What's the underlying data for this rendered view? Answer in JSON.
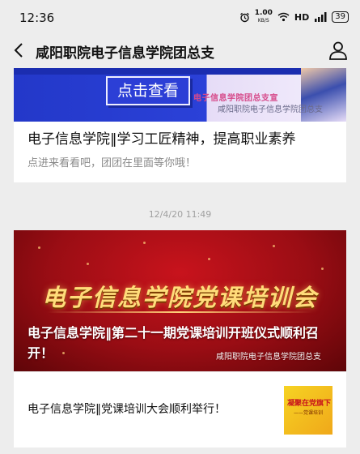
{
  "status_bar": {
    "time": "12:36",
    "net_speed_value": "1.00",
    "net_speed_unit": "KB/S",
    "network": "HD",
    "battery": "39"
  },
  "nav": {
    "title": "咸阳职院电子信息学院团总支",
    "icons": [
      "chevron-left-icon",
      "person-icon"
    ]
  },
  "article1": {
    "banner_button": "点击查看",
    "banner_brand": "电子信息学院团总支宣",
    "banner_watermark": "咸阳职院电子信息学院团总支",
    "title": "电子信息学院‖学习工匠精神，提高职业素养",
    "subtitle": "点进来看看吧，团团在里面等你哦！"
  },
  "timestamp": "12/4/20 11:49",
  "article2": {
    "banner_calligraphy": "电子信息学院党课培训会",
    "banner_title": "电子信息学院‖第二十一期党课培训开班仪式顺利召开！",
    "banner_watermark": "咸阳职院电子信息学院团总支",
    "item_text": "电子信息学院‖党课培训大会顺利举行！",
    "thumb_line1": "凝聚在党旗下",
    "thumb_line2": "——党课培训"
  },
  "colors": {
    "background": "#ededed",
    "banner1_blue": "#2338c9",
    "banner2_red": "#b8101a",
    "gold": "#ffdc7a"
  }
}
